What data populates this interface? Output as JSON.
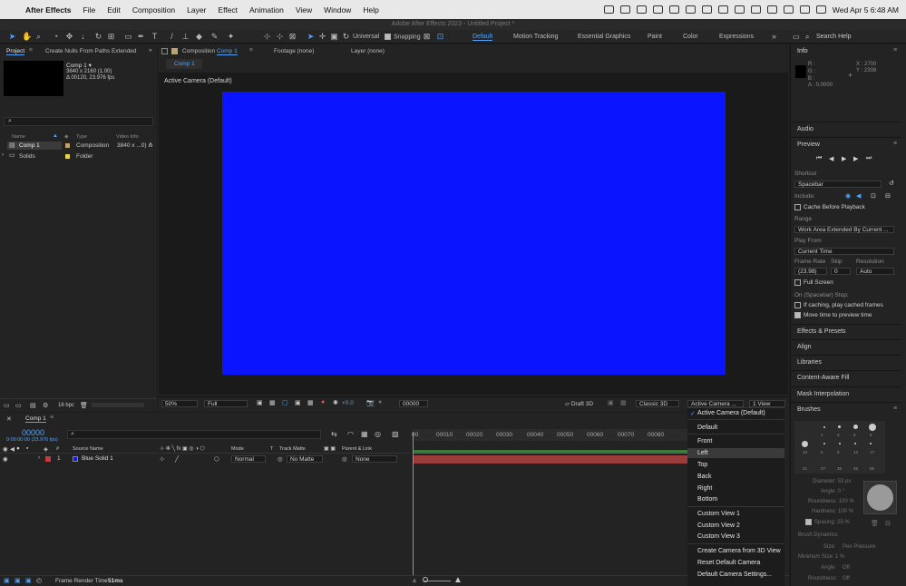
{
  "menubar": {
    "apple": "",
    "app": "After Effects",
    "items": [
      "File",
      "Edit",
      "Composition",
      "Layer",
      "Effect",
      "Animation",
      "View",
      "Window",
      "Help"
    ],
    "clock": "Wed Apr 5  6:48 AM"
  },
  "window": {
    "title": "Adobe After Effects 2023 - Untitled Project *"
  },
  "toolbar": {
    "universal": "Universal",
    "snapping": "Snapping",
    "workspaces": [
      "Default",
      "Motion Tracking",
      "Essential Graphics",
      "Paint",
      "Color",
      "Expressions"
    ],
    "search": "Search Help"
  },
  "project": {
    "tab": "Project",
    "script_tab": "Create Nulls From Paths Extended",
    "comp_name": "Comp 1 ▾",
    "comp_res": "3840 x 2160 (1.00)",
    "comp_dur": "Δ 00120, 23.976 fps",
    "search_placeholder": "",
    "headers": [
      "Name",
      "Type",
      "Video Info"
    ],
    "rows": [
      {
        "name": "Comp 1",
        "type": "Composition",
        "info": "3840 x ...0)",
        "color": "#bfa46a"
      },
      {
        "name": "Solids",
        "type": "Folder",
        "info": "",
        "color": "#e6d25a"
      }
    ],
    "bpc": "16 bpc"
  },
  "composition": {
    "tab": "Composition",
    "tab_name": "Comp 1",
    "footage": "Footage (none)",
    "layer": "Layer (none)",
    "subtab": "Comp 1",
    "camera_label": "Active Camera (Default)",
    "solid_color": "#0a14ff",
    "zoom": "50%",
    "quality": "Full",
    "exposure": "+0.0",
    "frame": "00000",
    "draft": "Draft 3D",
    "renderer": "Classic 3D",
    "view_select": "Active Camera ...",
    "views": "1 View"
  },
  "camera_menu": {
    "items": [
      "Active Camera (Default)",
      "Default",
      "Front",
      "Left",
      "Top",
      "Back",
      "Right",
      "Bottom",
      "Custom View 1",
      "Custom View 2",
      "Custom View 3",
      "Create Camera from 3D View",
      "Reset Default Camera",
      "Default Camera Settings..."
    ],
    "checked": "Active Camera (Default)",
    "highlighted": "Left"
  },
  "timeline": {
    "tab": "Comp 1",
    "timecode": "00000",
    "timecode_sub": "0:00:00:00 (23.976 fps)",
    "headers": [
      "Source Name",
      "Mode",
      "T",
      "Track Matte",
      "Parent & Link"
    ],
    "layer": {
      "index": "1",
      "name": "Blue Solid 1",
      "mode": "Normal",
      "matte": "No Matte",
      "parent": "None",
      "color": "#c83a3a"
    },
    "ticks": [
      "00010",
      "00020",
      "00030",
      "00040",
      "00050",
      "00060",
      "00070",
      "00080"
    ],
    "start": "00",
    "render_time_label": "Frame Render Time",
    "render_time": "51ms"
  },
  "info": {
    "title": "Info",
    "r": "R :",
    "g": "G :",
    "b": "B :",
    "a": "A :  0.0000",
    "x": "X : 2700",
    "y": "Y : 2308"
  },
  "audio": {
    "title": "Audio"
  },
  "preview": {
    "title": "Preview",
    "shortcut_label": "Shortcut",
    "shortcut": "Spacebar",
    "include": "Include:",
    "cache": "Cache Before Playback",
    "range_label": "Range",
    "range": "Work Area Extended By Current ...",
    "playfrom_label": "Play From",
    "playfrom": "Current Time",
    "framerate_label": "Frame Rate",
    "skip_label": "Skip",
    "resolution_label": "Resolution",
    "framerate": "(23.98)",
    "skip": "0",
    "resolution": "Auto",
    "fullscreen": "Full Screen",
    "stop_label": "On (Spacebar) Stop:",
    "stop1": "If caching, play cached frames",
    "stop2": "Move time to preview time"
  },
  "panels": [
    "Effects & Presets",
    "Align",
    "Libraries",
    "Content-Aware Fill",
    "Mask Interpolation",
    "Brushes"
  ],
  "brushes": {
    "sizes": [
      "1",
      "3",
      "5",
      "9",
      "13",
      "19",
      "5",
      "9",
      "13",
      "17",
      "21",
      "27",
      "35",
      "45",
      "65"
    ],
    "diameter": "Diameter: 53 px",
    "angle": "Angle: 0 °",
    "roundness": "Roundness: 100 %",
    "hardness": "Hardness: 100 %",
    "spacing": "Spacing: 25 %",
    "dynamics": "Brush Dynamics",
    "size": "Size:",
    "size_val": "Pen Pressure",
    "min_size": "Minimum Size: 1 %",
    "angle2": "Angle:",
    "angle2_val": "Off",
    "roundness2": "Roundness:",
    "roundness2_val": "Off"
  }
}
